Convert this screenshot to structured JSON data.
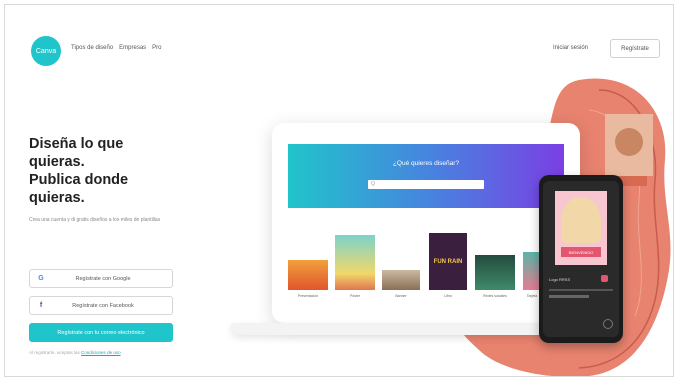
{
  "header": {
    "logo_text": "Canva",
    "nav": [
      "Tipos de diseño",
      "Empresas",
      "Pro"
    ],
    "login_label": "Iniciar sesión",
    "register_label": "Regístrate"
  },
  "hero": {
    "headline": [
      "Diseña lo que",
      "quieras.",
      "Publica donde",
      "quieras."
    ],
    "subtext": "Crea una cuenta y di gratis diseños a los miles de plantillas",
    "google_button": "Regístrate con Google",
    "facebook_button": "Regístrate con Facebook",
    "email_button": "Regístrate con tu correo electrónico",
    "fine_print": "Al registrarte, aceptas las",
    "fine_print_link": "Condiciones de uso"
  },
  "mockup": {
    "banner_title": "¿Qué quieres diseñar?",
    "search_placeholder": "Q",
    "thumbnails": [
      "Presentación",
      "Póster",
      "Banner",
      "Libro",
      "Redes sociales",
      "Tarjeta"
    ],
    "poster_text": "FUN RAIN",
    "phone_card_text": "BIENVENIDO",
    "phone_label": "Logo RRSS"
  },
  "colors": {
    "accent": "#20c4cb",
    "blob": "#e8836f",
    "gradient_end": "#7b3fe4"
  }
}
